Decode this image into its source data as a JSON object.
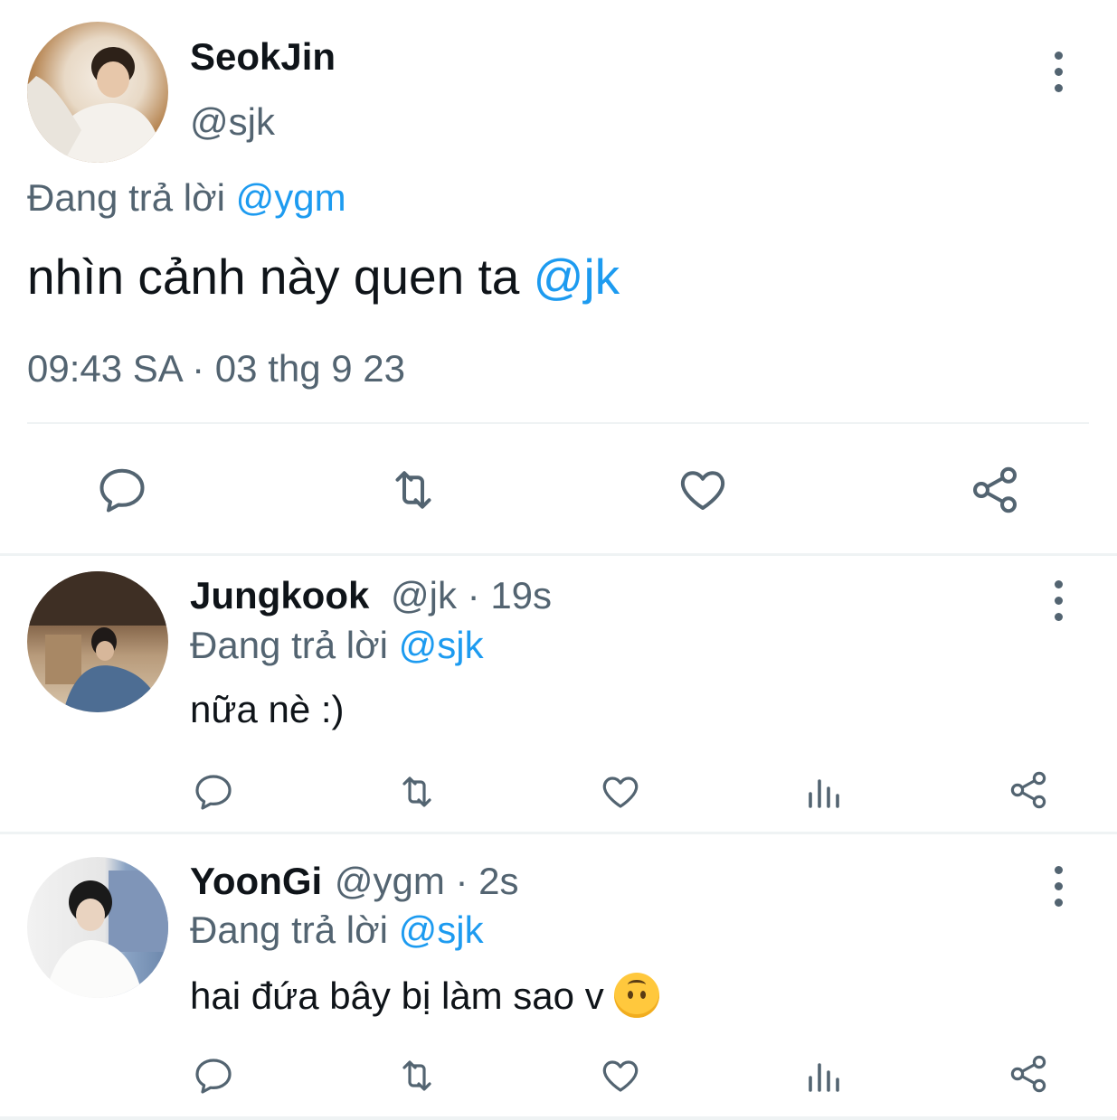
{
  "main_tweet": {
    "display_name": "SeokJin",
    "handle": "@sjk",
    "replying_to_label": "Đang trả lời",
    "replying_to_handle": "@ygm",
    "text": "nhìn cảnh này quen ta",
    "text_mention": "@jk",
    "timestamp": "09:43 SA · 03 thg 9 23"
  },
  "replies": [
    {
      "display_name": "Jungkook",
      "handle": "@jk",
      "age": "· 19s",
      "replying_to_label": "Đang trả lời",
      "replying_to_handle": "@sjk",
      "text": "nữa nè :)"
    },
    {
      "display_name": "YoonGi",
      "handle": "@ygm",
      "age": "· 2s",
      "replying_to_label": "Đang trả lời",
      "replying_to_handle": "@sjk",
      "text": "hai đứa bây bị làm sao v",
      "emoji": "upside-down-face"
    }
  ],
  "icons": {
    "reply": "reply-icon",
    "retweet": "retweet-icon",
    "like": "like-icon",
    "views": "views-icon",
    "share": "share-icon",
    "more": "more-options-icon"
  },
  "colors": {
    "text": "#0f1419",
    "secondary": "#536471",
    "link": "#1d9bf0",
    "divider": "#eff3f4"
  }
}
